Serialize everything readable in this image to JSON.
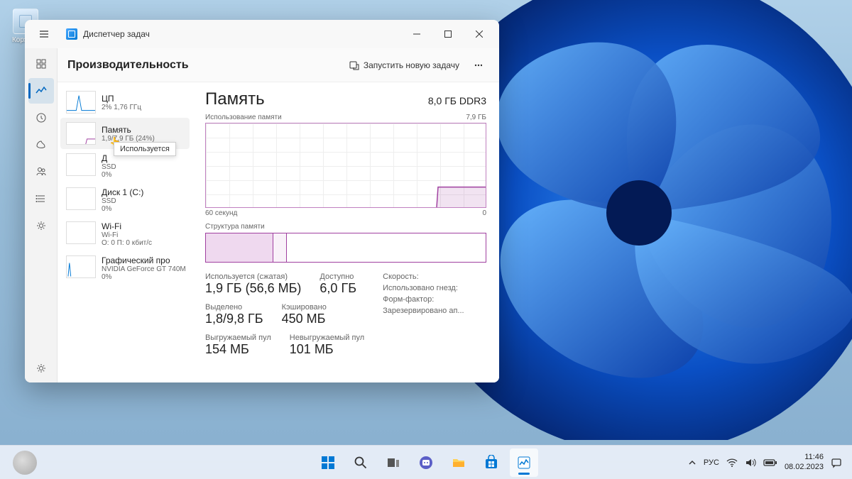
{
  "desktop": {
    "recycle": "Корзина"
  },
  "window": {
    "title": "Диспетчер задач",
    "toolbar": {
      "section": "Производительность",
      "runNew": "Запустить новую задачу"
    }
  },
  "perfList": {
    "cpu": {
      "name": "ЦП",
      "sub": "2% 1,76 ГГц"
    },
    "mem": {
      "name": "Память",
      "sub": "1,9/7,9 ГБ (24%)",
      "tooltip": "Используется"
    },
    "disk0": {
      "name": "Д",
      "sub1": "SSD",
      "sub2": "0%"
    },
    "disk1": {
      "name": "Диск 1 (C:)",
      "sub1": "SSD",
      "sub2": "0%"
    },
    "wifi": {
      "name": "Wi-Fi",
      "sub1": "Wi-Fi",
      "sub2": "О: 0 П: 0 кбит/с"
    },
    "gpu": {
      "name": "Графический про",
      "sub1": "NVIDIA GeForce GT 740M",
      "sub2": "0%"
    }
  },
  "detail": {
    "title": "Память",
    "spec": "8,0 ГБ DDR3",
    "chartLabelLeft": "Использование памяти",
    "chartLabelRight": "7,9 ГБ",
    "chartBottomLeft": "60 секунд",
    "chartBottomRight": "0",
    "structLabel": "Структура памяти",
    "stats": {
      "usedLabel": "Используется (сжатая)",
      "usedVal": "1,9 ГБ (56,6 МБ)",
      "availLabel": "Доступно",
      "availVal": "6,0 ГБ",
      "allocLabel": "Выделено",
      "allocVal": "1,8/9,8 ГБ",
      "cachedLabel": "Кэшировано",
      "cachedVal": "450 МБ",
      "pagedLabel": "Выгружаемый пул",
      "pagedVal": "154 МБ",
      "nonpagedLabel": "Невыгружаемый пул",
      "nonpagedVal": "101 МБ"
    },
    "hw": {
      "speed": "Скорость:",
      "slots": "Использовано гнезд:",
      "form": "Форм-фактор:",
      "reserved": "Зарезервировано ап..."
    }
  },
  "taskbar": {
    "lang": "РУС",
    "time": "11:46",
    "date": "08.02.2023"
  },
  "chart_data": {
    "type": "area",
    "title": "Использование памяти",
    "ylim": [
      0,
      7.9
    ],
    "yunit": "ГБ",
    "x_seconds": [
      60,
      55,
      50,
      45,
      40,
      35,
      30,
      25,
      20,
      15,
      10,
      5,
      0
    ],
    "values": [
      0,
      0,
      0,
      0,
      0,
      0,
      0,
      0,
      0,
      0,
      1.85,
      1.9,
      1.9
    ]
  }
}
